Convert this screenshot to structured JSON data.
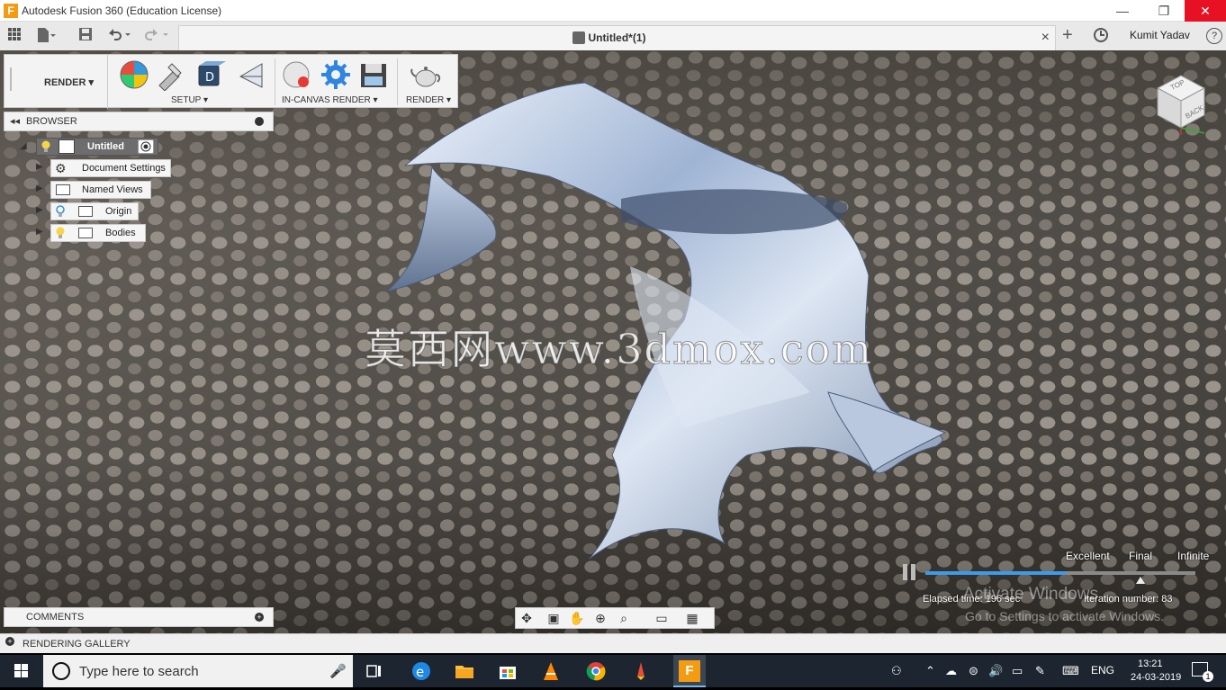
{
  "window": {
    "title": "Autodesk Fusion 360 (Education License)",
    "minimize": "—",
    "maximize": "❐",
    "close": "✕"
  },
  "tab": {
    "label": "Untitled*(1)",
    "close": "×",
    "new": "+",
    "user": "Kumit Yadav",
    "help": "?"
  },
  "render_panel": {
    "workspace": "RENDER ▾",
    "groups": [
      "SETUP ▾",
      "IN-CANVAS RENDER ▾",
      "RENDER ▾"
    ]
  },
  "browser": {
    "title": "BROWSER",
    "items": [
      {
        "label": "Untitled"
      },
      {
        "label": "Document Settings"
      },
      {
        "label": "Named Views"
      },
      {
        "label": "Origin"
      },
      {
        "label": "Bodies"
      }
    ]
  },
  "comments": {
    "title": "COMMENTS"
  },
  "gallery": {
    "title": "RENDERING GALLERY"
  },
  "render_status": {
    "quality_labels": [
      "Excellent",
      "Final",
      "Infinite"
    ],
    "progress": 0.52,
    "elapsed": "Elapsed time: 196 sec",
    "iteration": "Iteration number: 83"
  },
  "viewcube": {
    "top": "TOP",
    "back": "BACK"
  },
  "watermark": "莫西网www.3dmox.com",
  "activation": {
    "line1": "Activate Windows",
    "line2": "Go to Settings to activate Windows."
  },
  "taskbar": {
    "search_placeholder": "Type here to search",
    "language": "ENG",
    "time": "13:21",
    "date": "24-03-2019",
    "notifications": "1"
  },
  "colors": {
    "accent": "#3d9bea",
    "close_red": "#e81123",
    "fusion_orange": "#f39c12"
  }
}
